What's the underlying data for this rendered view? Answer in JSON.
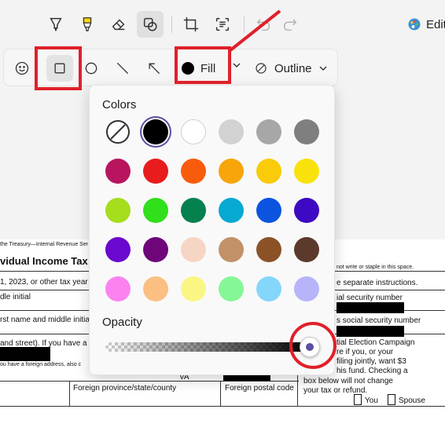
{
  "top_toolbar": {
    "tools": [
      {
        "name": "pen-icon"
      },
      {
        "name": "highlighter-icon"
      },
      {
        "name": "eraser-icon"
      },
      {
        "name": "shapes-icon",
        "active": true
      },
      {
        "name": "crop-icon"
      },
      {
        "name": "text-recognition-icon"
      },
      {
        "name": "undo-icon"
      },
      {
        "name": "redo-icon"
      }
    ],
    "edit_label": "Edit"
  },
  "shape_toolbar": {
    "tools": [
      {
        "name": "emoji-icon"
      },
      {
        "name": "rectangle-icon",
        "active": true
      },
      {
        "name": "circle-icon"
      },
      {
        "name": "line-icon"
      },
      {
        "name": "arrow-icon"
      }
    ],
    "fill_label": "Fill",
    "fill_color": "#000000",
    "outline_label": "Outline"
  },
  "color_panel": {
    "colors_title": "Colors",
    "selected_color": "#000000",
    "swatches": [
      "none",
      "#000000",
      "#ffffff",
      "#d2d2d2",
      "#a7a7a7",
      "#7f7f7f",
      "#b8155f",
      "#e81c1c",
      "#f95b0d",
      "#f7a50a",
      "#f9cb08",
      "#f9e20c",
      "#a4de1c",
      "#2fe01a",
      "#05804f",
      "#06a9d1",
      "#0a54e0",
      "#3e09c2",
      "#6a08cf",
      "#6e067a",
      "#f7d5c4",
      "#c29168",
      "#8b5228",
      "#5b3a2c",
      "#fb82f0",
      "#fbbf82",
      "#fbf683",
      "#86f796",
      "#84d6fb",
      "#b8b4f9"
    ],
    "opacity_title": "Opacity",
    "opacity_value": 1.0,
    "accent_color": "#5a4fa3"
  },
  "document": {
    "lines": [
      "the Treasury—Internal Revenue Ser",
      "vidual Income Tax R",
      "1, 2023, or other tax year b",
      "dle initial",
      "rst name and middle initial",
      "and street). If you have a P.",
      "ou have a foreign address, also c",
      "Foreign province/state/county",
      "Foreign postal code",
      "VA",
      "not write or staple in this space.",
      "e separate instructions.",
      "ial security number",
      "s social security number",
      "tial Election Campaign",
      "re if you, or your",
      "filing jointly, want $3",
      "his fund. Checking a",
      "box below will not change",
      "your tax or refund.",
      "You",
      "Spouse"
    ]
  },
  "annotation_color": "#e0202a"
}
